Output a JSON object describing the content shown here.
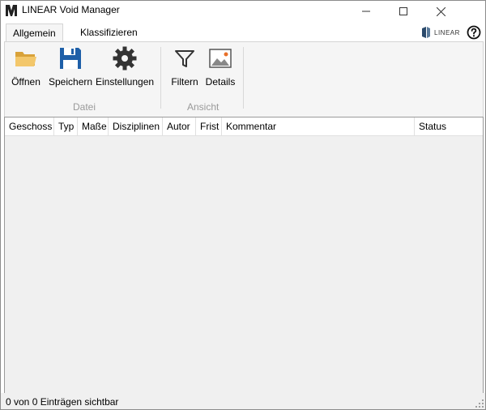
{
  "window": {
    "title": "LINEAR Void Manager"
  },
  "tabs": [
    {
      "label": "Allgemein",
      "active": true
    },
    {
      "label": "Klassifizieren",
      "active": false
    }
  ],
  "brand": {
    "text": "LINEAR"
  },
  "ribbon": {
    "groups": [
      {
        "label": "Datei",
        "buttons": [
          {
            "label": "Öffnen",
            "icon": "folder-open-icon"
          },
          {
            "label": "Speichern",
            "icon": "save-icon"
          },
          {
            "label": "Einstellungen",
            "icon": "gear-icon"
          }
        ]
      },
      {
        "label": "Ansicht",
        "buttons": [
          {
            "label": "Filtern",
            "icon": "filter-icon"
          },
          {
            "label": "Details",
            "icon": "image-details-icon"
          }
        ]
      }
    ]
  },
  "table": {
    "columns": [
      "Geschoss",
      "Typ",
      "Maße",
      "Disziplinen",
      "Autor",
      "Frist",
      "Kommentar",
      "Status"
    ],
    "rows": []
  },
  "status": {
    "text": "0 von 0 Einträgen sichtbar"
  },
  "colors": {
    "accent_blue": "#1e5fa8",
    "folder_yellow": "#e8b84a",
    "details_orange": "#e8702a"
  }
}
